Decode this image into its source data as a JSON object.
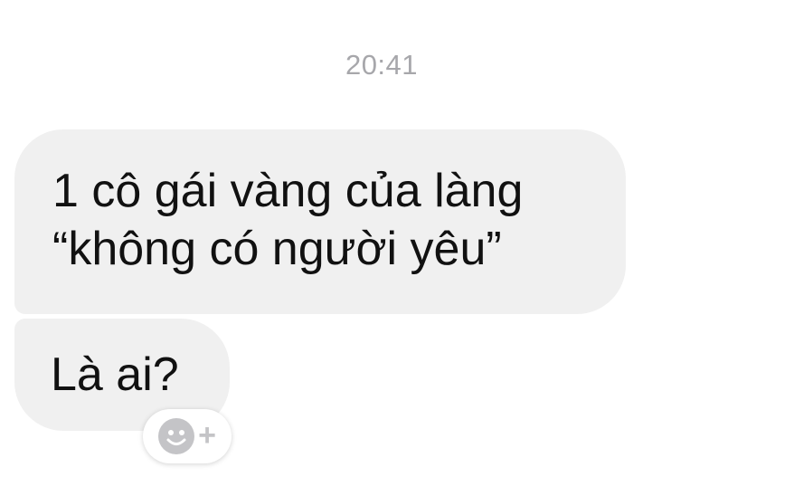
{
  "conversation": {
    "timestamp": "20:41",
    "messages": [
      {
        "lines": [
          "1 cô gái vàng của làng",
          "“không có người yêu”"
        ]
      },
      {
        "lines": [
          "Là ai?"
        ]
      }
    ],
    "reaction_button": {
      "icon": "smiley-plus-icon",
      "plus_label": "+"
    }
  },
  "colors": {
    "bubble": "#f0f0f0",
    "timestamp": "#a7a7ab",
    "reaction_icon": "#c4c4c7"
  }
}
